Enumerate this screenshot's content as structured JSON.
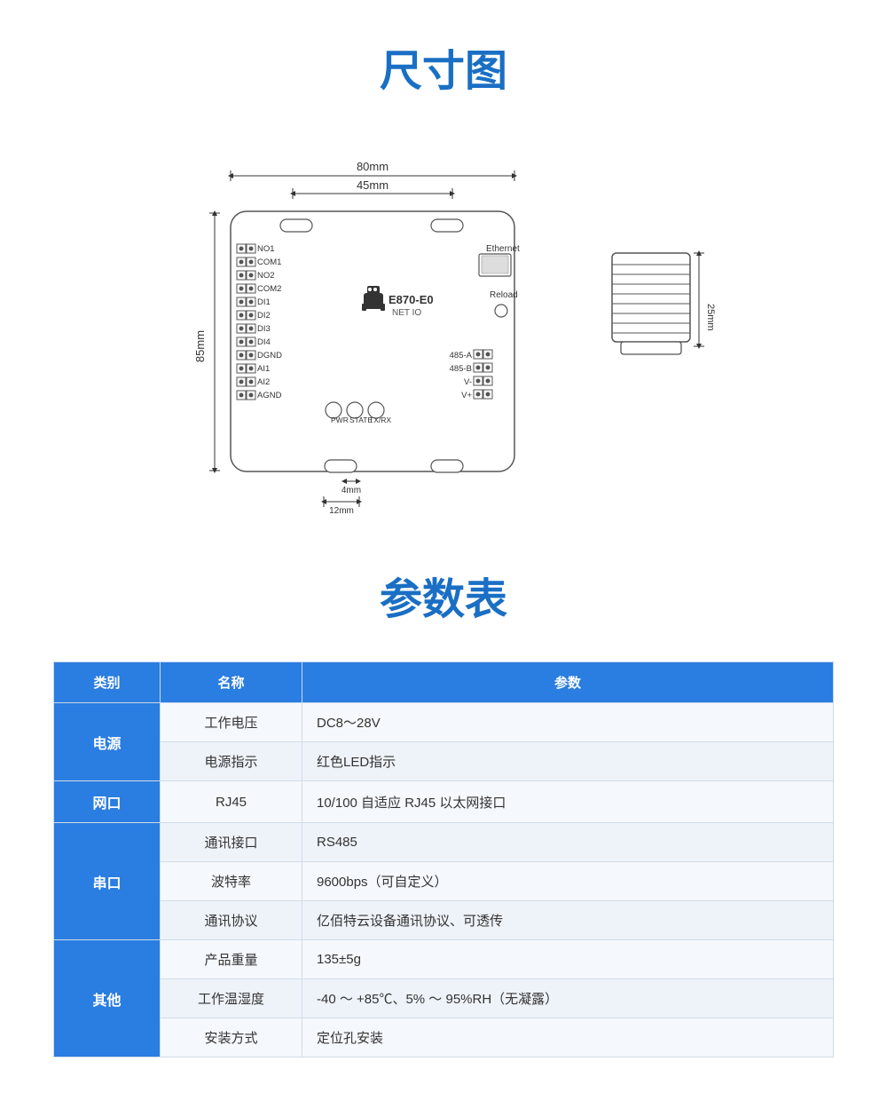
{
  "titles": {
    "dimension": "尺寸图",
    "params": "参数表"
  },
  "dimensions": {
    "width_outer": "80mm",
    "width_inner": "45mm",
    "height": "85mm",
    "side_height": "25mm",
    "bottom_dim": "4mm",
    "bottom_width": "12mm"
  },
  "device": {
    "model": "E870-E0",
    "subtitle": "NET IO",
    "labels_left": [
      "NO1",
      "COM1",
      "NO2",
      "COM2",
      "DI1",
      "DI2",
      "DI3",
      "DI4",
      "DGND",
      "AI1",
      "AI2",
      "AGND"
    ],
    "labels_indicators": [
      "PWR",
      "STATE",
      "TX/RX"
    ],
    "labels_right": [
      "485-A",
      "485-B",
      "V-",
      "V+"
    ],
    "label_ethernet": "Ethernet",
    "label_reload": "Reload"
  },
  "table": {
    "headers": [
      "类别",
      "名称",
      "参数"
    ],
    "rows": [
      {
        "category": "电源",
        "rowspan": 2,
        "name": "工作电压",
        "value": "DC8～28V"
      },
      {
        "category": null,
        "name": "电源指示",
        "value": "红色LED指示"
      },
      {
        "category": "网口",
        "rowspan": 1,
        "name": "RJ45",
        "value": "10/100 自适应 RJ45 以太网接口"
      },
      {
        "category": "串口",
        "rowspan": 3,
        "name": "通讯接口",
        "value": "RS485"
      },
      {
        "category": null,
        "name": "波特率",
        "value": "9600bps（可自定义）"
      },
      {
        "category": null,
        "name": "通讯协议",
        "value": "亿佰特云设备通讯协议、可透传"
      },
      {
        "category": "其他",
        "rowspan": 3,
        "name": "产品重量",
        "value": "135±5g"
      },
      {
        "category": null,
        "name": "工作温湿度",
        "value": "-40 ～ +85℃、5% ～ 95%RH（无凝露）"
      },
      {
        "category": null,
        "name": "安装方式",
        "value": "定位孔安装"
      }
    ]
  }
}
